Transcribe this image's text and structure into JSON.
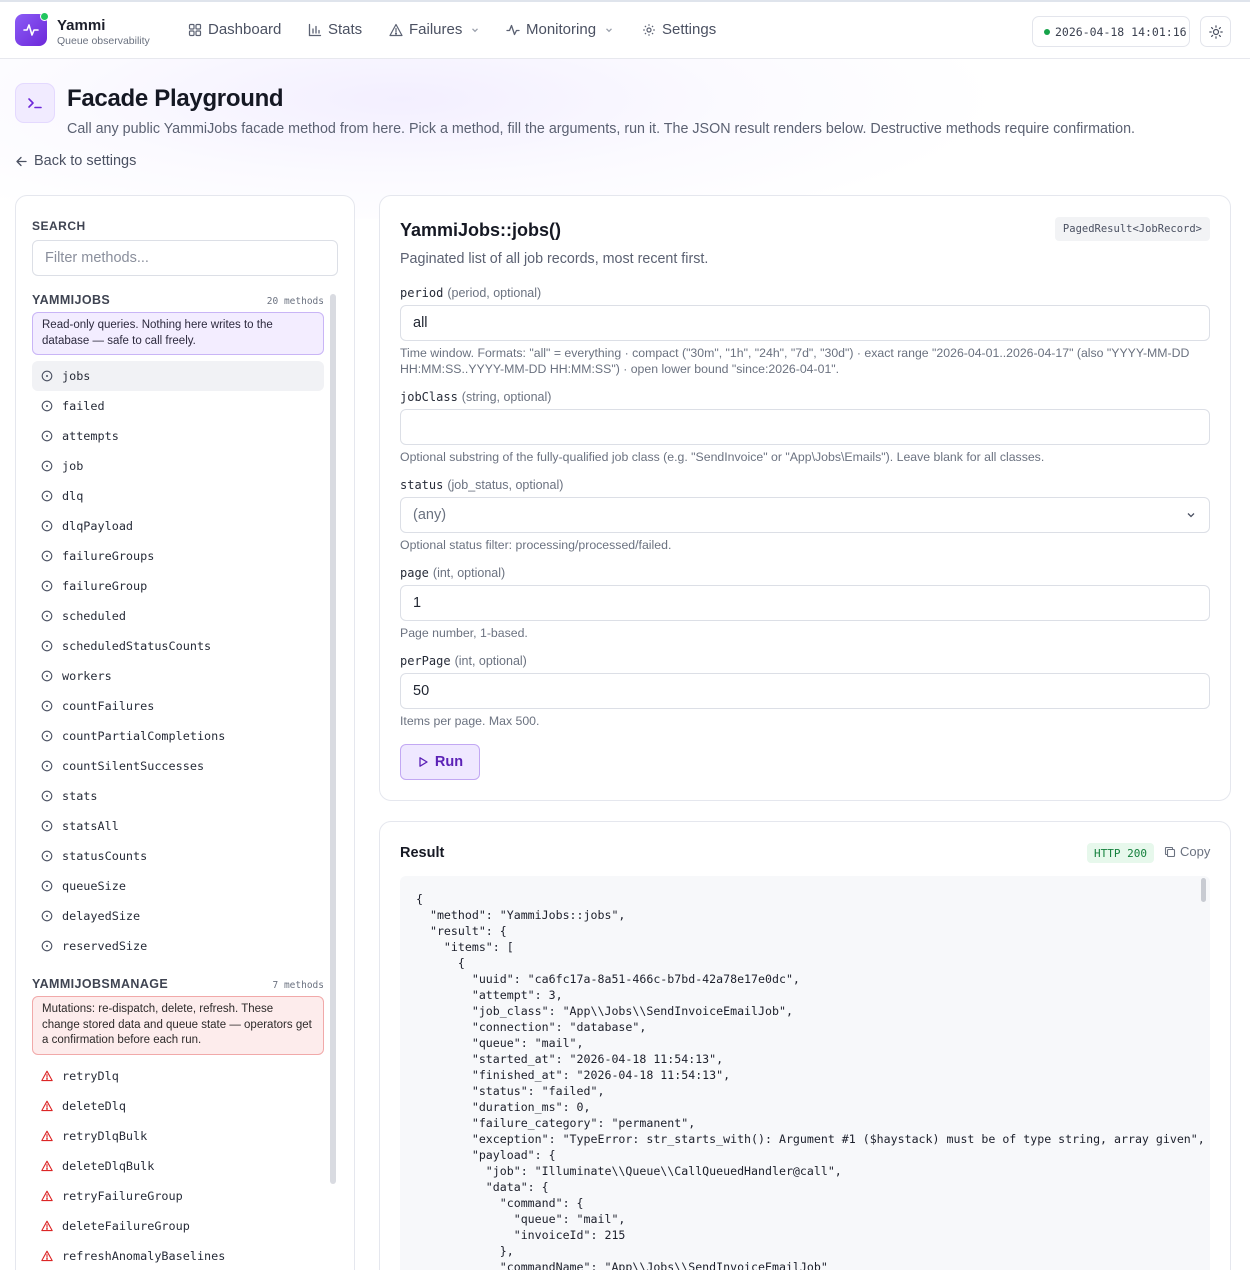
{
  "app": {
    "name": "Yammi",
    "subtitle": "Queue observability"
  },
  "nav": {
    "items": [
      {
        "label": "Dashboard",
        "icon": "grid-icon"
      },
      {
        "label": "Stats",
        "icon": "bar-chart-icon"
      },
      {
        "label": "Failures",
        "icon": "warning-icon"
      },
      {
        "label": "Monitoring",
        "icon": "activity-icon"
      },
      {
        "label": "Settings",
        "icon": "gear-icon"
      }
    ],
    "clock": "2026-04-18 14:01:16"
  },
  "page": {
    "title": "Facade Playground",
    "description": "Call any public YammiJobs facade method from here. Pick a method, fill the arguments, run it. The JSON result renders below. Destructive methods require confirmation.",
    "back_label": "Back to settings"
  },
  "sidebar": {
    "search_label": "SEARCH",
    "search_placeholder": "Filter methods...",
    "groups": [
      {
        "title": "YAMMIJOBS",
        "count": "20 methods",
        "note": "Read-only queries. Nothing here writes to the database — safe to call freely.",
        "methods": [
          "jobs",
          "failed",
          "attempts",
          "job",
          "dlq",
          "dlqPayload",
          "failureGroups",
          "failureGroup",
          "scheduled",
          "scheduledStatusCounts",
          "workers",
          "countFailures",
          "countPartialCompletions",
          "countSilentSuccesses",
          "stats",
          "statsAll",
          "statusCounts",
          "queueSize",
          "delayedSize",
          "reservedSize"
        ]
      },
      {
        "title": "YAMMIJOBSMANAGE",
        "count": "7 methods",
        "note": "Mutations: re-dispatch, delete, refresh. These change stored data and queue state — operators get a confirmation before each run.",
        "methods": [
          "retryDlq",
          "deleteDlq",
          "retryDlqBulk",
          "deleteDlqBulk",
          "retryFailureGroup",
          "deleteFailureGroup",
          "refreshAnomalyBaselines"
        ]
      }
    ]
  },
  "form": {
    "method_title": "YammiJobs::jobs()",
    "return_type": "PagedResult<JobRecord>",
    "description": "Paginated list of all job records, most recent first.",
    "fields": [
      {
        "name": "period",
        "meta": "(period, optional)",
        "value": "all",
        "help": "Time window. Formats: \"all\" = everything · compact (\"30m\", \"1h\", \"24h\", \"7d\", \"30d\") · exact range \"2026-04-01..2026-04-17\" (also \"YYYY-MM-DD HH:MM:SS..YYYY-MM-DD HH:MM:SS\") · open lower bound \"since:2026-04-01\"."
      },
      {
        "name": "jobClass",
        "meta": "(string, optional)",
        "value": "",
        "help": "Optional substring of the fully-qualified job class (e.g. \"SendInvoice\" or \"App\\Jobs\\Emails\"). Leave blank for all classes."
      },
      {
        "name": "status",
        "meta": "(job_status, optional)",
        "value": "(any)",
        "help": "Optional status filter: processing/processed/failed."
      },
      {
        "name": "page",
        "meta": "(int, optional)",
        "value": "1",
        "help": "Page number, 1-based."
      },
      {
        "name": "perPage",
        "meta": "(int, optional)",
        "value": "50",
        "help": "Items per page. Max 500."
      }
    ],
    "run_label": "Run"
  },
  "result": {
    "title": "Result",
    "status": "HTTP 200",
    "copy_label": "Copy",
    "json_lines": [
      "{",
      "  \"method\": \"YammiJobs::jobs\",",
      "  \"result\": {",
      "    \"items\": [",
      "      {",
      "        \"uuid\": \"ca6fc17a-8a51-466c-b7bd-42a78e17e0dc\",",
      "        \"attempt\": 3,",
      "        \"job_class\": \"App\\\\Jobs\\\\SendInvoiceEmailJob\",",
      "        \"connection\": \"database\",",
      "        \"queue\": \"mail\",",
      "        \"started_at\": \"2026-04-18 11:54:13\",",
      "        \"finished_at\": \"2026-04-18 11:54:13\",",
      "        \"status\": \"failed\",",
      "        \"duration_ms\": 0,",
      "        \"failure_category\": \"permanent\",",
      "        \"exception\": \"TypeError: str_starts_with(): Argument #1 ($haystack) must be of type string, array given\",",
      "        \"payload\": {",
      "          \"job\": \"Illuminate\\\\Queue\\\\CallQueuedHandler@call\",",
      "          \"data\": {",
      "            \"command\": {",
      "              \"queue\": \"mail\",",
      "              \"invoiceId\": 215",
      "            },",
      "            \"commandName\": \"App\\\\Jobs\\\\SendInvoiceEmailJob\""
    ]
  },
  "colors": {
    "accent": "#7c3aed",
    "success": "#15803d",
    "danger": "#dc2626"
  }
}
